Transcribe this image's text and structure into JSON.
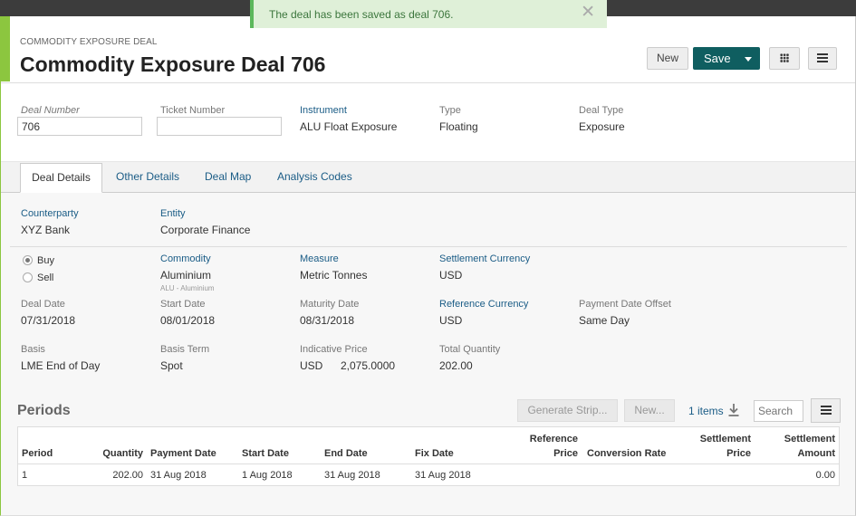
{
  "toast": {
    "message": "The deal has been saved as deal 706."
  },
  "header": {
    "subtitle": "COMMODITY EXPOSURE DEAL",
    "title": "Commodity Exposure Deal 706",
    "new_label": "New",
    "save_label": "Save"
  },
  "top_fields": {
    "deal_number": {
      "label": "Deal Number",
      "value": "706"
    },
    "ticket_number": {
      "label": "Ticket Number",
      "value": ""
    },
    "instrument": {
      "label": "Instrument",
      "value": "ALU Float Exposure"
    },
    "type": {
      "label": "Type",
      "value": "Floating"
    },
    "deal_type": {
      "label": "Deal Type",
      "value": "Exposure"
    }
  },
  "tabs": [
    "Deal Details",
    "Other Details",
    "Deal Map",
    "Analysis Codes"
  ],
  "details": {
    "counterparty": {
      "label": "Counterparty",
      "value": "XYZ Bank"
    },
    "entity": {
      "label": "Entity",
      "value": "Corporate Finance"
    },
    "buy_label": "Buy",
    "sell_label": "Sell",
    "commodity": {
      "label": "Commodity",
      "value": "Aluminium",
      "sub": "ALU - Aluminium"
    },
    "measure": {
      "label": "Measure",
      "value": "Metric Tonnes"
    },
    "settlement_currency": {
      "label": "Settlement Currency",
      "value": "USD"
    },
    "deal_date": {
      "label": "Deal Date",
      "value": "07/31/2018"
    },
    "start_date": {
      "label": "Start Date",
      "value": "08/01/2018"
    },
    "maturity_date": {
      "label": "Maturity Date",
      "value": "08/31/2018"
    },
    "reference_currency": {
      "label": "Reference Currency",
      "value": "USD"
    },
    "payment_date_offset": {
      "label": "Payment Date Offset",
      "value": "Same Day"
    },
    "basis": {
      "label": "Basis",
      "value": "LME End of Day"
    },
    "basis_term": {
      "label": "Basis Term",
      "value": "Spot"
    },
    "indicative_price": {
      "label": "Indicative Price",
      "currency": "USD",
      "value": "2,075.0000"
    },
    "total_quantity": {
      "label": "Total Quantity",
      "value": "202.00"
    }
  },
  "periods": {
    "title": "Periods",
    "generate_label": "Generate Strip...",
    "new_label": "New...",
    "items_label": "1 items",
    "search_placeholder": "Search",
    "columns": {
      "period": "Period",
      "quantity": "Quantity",
      "payment_date": "Payment Date",
      "start_date": "Start Date",
      "end_date": "End Date",
      "fix_date": "Fix Date",
      "reference_price_1": "Reference",
      "reference_price_2": "Price",
      "conversion_rate": "Conversion Rate",
      "settlement_price_1": "Settlement",
      "settlement_price_2": "Price",
      "settlement_amount_1": "Settlement",
      "settlement_amount_2": "Amount"
    },
    "rows": [
      {
        "period": "1",
        "quantity": "202.00",
        "payment_date": "31 Aug 2018",
        "start_date": "1 Aug 2018",
        "end_date": "31 Aug 2018",
        "fix_date": "31 Aug 2018",
        "reference_price": "",
        "conversion_rate": "",
        "settlement_price": "",
        "settlement_amount": "0.00"
      }
    ]
  }
}
